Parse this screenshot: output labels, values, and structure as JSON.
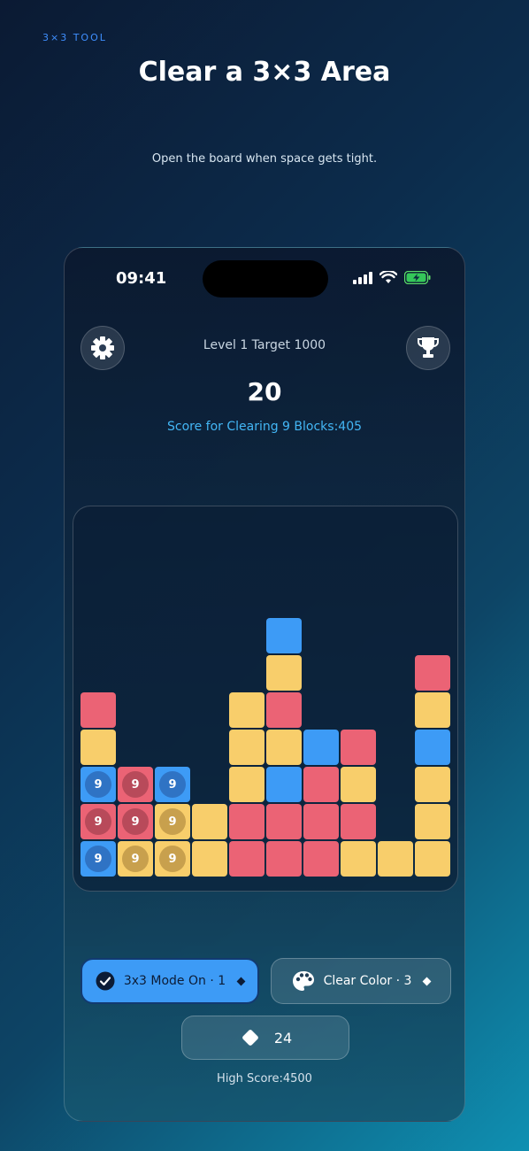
{
  "eyebrow": "3×3 TOOL",
  "title": "Clear a 3×3 Area",
  "subtitle": "Open the board when space gets tight.",
  "status": {
    "time": "09:41"
  },
  "header": {
    "level_text": "Level 1 Target 1000",
    "score": "20",
    "clear_score": "Score for Clearing 9 Blocks:405"
  },
  "board": {
    "columns": 10,
    "rows": 10,
    "cells": [
      {
        "col": 5,
        "row": 0,
        "color": "b"
      },
      {
        "col": 5,
        "row": 1,
        "color": "y"
      },
      {
        "col": 9,
        "row": 1,
        "color": "r"
      },
      {
        "col": 0,
        "row": 2,
        "color": "r"
      },
      {
        "col": 4,
        "row": 2,
        "color": "y"
      },
      {
        "col": 5,
        "row": 2,
        "color": "r"
      },
      {
        "col": 9,
        "row": 2,
        "color": "y"
      },
      {
        "col": 0,
        "row": 3,
        "color": "y"
      },
      {
        "col": 4,
        "row": 3,
        "color": "y"
      },
      {
        "col": 5,
        "row": 3,
        "color": "y"
      },
      {
        "col": 6,
        "row": 3,
        "color": "b"
      },
      {
        "col": 7,
        "row": 3,
        "color": "r"
      },
      {
        "col": 9,
        "row": 3,
        "color": "b"
      },
      {
        "col": 0,
        "row": 4,
        "color": "b",
        "label": "9"
      },
      {
        "col": 1,
        "row": 4,
        "color": "r",
        "label": "9"
      },
      {
        "col": 2,
        "row": 4,
        "color": "b",
        "label": "9"
      },
      {
        "col": 4,
        "row": 4,
        "color": "y"
      },
      {
        "col": 5,
        "row": 4,
        "color": "b"
      },
      {
        "col": 6,
        "row": 4,
        "color": "r"
      },
      {
        "col": 7,
        "row": 4,
        "color": "y"
      },
      {
        "col": 9,
        "row": 4,
        "color": "y"
      },
      {
        "col": 0,
        "row": 5,
        "color": "r",
        "label": "9"
      },
      {
        "col": 1,
        "row": 5,
        "color": "r",
        "label": "9"
      },
      {
        "col": 2,
        "row": 5,
        "color": "y",
        "label": "9"
      },
      {
        "col": 3,
        "row": 5,
        "color": "y"
      },
      {
        "col": 4,
        "row": 5,
        "color": "r"
      },
      {
        "col": 5,
        "row": 5,
        "color": "r"
      },
      {
        "col": 6,
        "row": 5,
        "color": "r"
      },
      {
        "col": 7,
        "row": 5,
        "color": "r"
      },
      {
        "col": 9,
        "row": 5,
        "color": "y"
      },
      {
        "col": 0,
        "row": 6,
        "color": "b",
        "label": "9"
      },
      {
        "col": 1,
        "row": 6,
        "color": "y",
        "label": "9"
      },
      {
        "col": 2,
        "row": 6,
        "color": "y",
        "label": "9"
      },
      {
        "col": 3,
        "row": 6,
        "color": "y"
      },
      {
        "col": 4,
        "row": 6,
        "color": "r"
      },
      {
        "col": 5,
        "row": 6,
        "color": "r"
      },
      {
        "col": 6,
        "row": 6,
        "color": "r"
      },
      {
        "col": 7,
        "row": 6,
        "color": "y"
      },
      {
        "col": 8,
        "row": 6,
        "color": "y"
      },
      {
        "col": 9,
        "row": 6,
        "color": "y"
      }
    ],
    "colors": {
      "r": "#eb6375",
      "y": "#f8ce6b",
      "b": "#3d9bf6"
    }
  },
  "buttons": {
    "mode_label": "3x3 Mode On · 1",
    "color_label": "Clear Color · 3",
    "gems": "24"
  },
  "footer": {
    "high_score": "High Score:4500"
  },
  "icons": {
    "settings": "gear-icon",
    "leaderboard": "trophy-icon",
    "mode": "check-circle-icon",
    "color": "palette-icon",
    "gems": "diamond-icon"
  }
}
